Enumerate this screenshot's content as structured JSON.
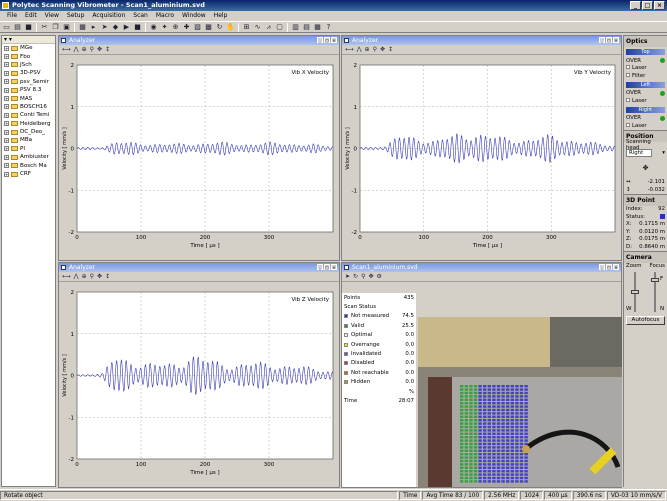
{
  "window": {
    "title": "Polytec Scanning Vibrometer - Scan1_aluminium.svd"
  },
  "menu": [
    "File",
    "Edit",
    "View",
    "Setup",
    "Acquisition",
    "Scan",
    "Macro",
    "Window",
    "Help"
  ],
  "tree": {
    "items": [
      "MGe",
      "Fbo",
      "JSch",
      "3D-PSV",
      "psv_Semir",
      "PSV 8.3",
      "MAS",
      "BOSCH16",
      "Conti Temi",
      "Heidelberg",
      "DC_Deo_",
      "MBa",
      "PI",
      "Ambiuster",
      "Bosch Ma",
      "CRF"
    ]
  },
  "analyzer_title": "Analyzer",
  "scan_window_title": "Scan1_aluminium.svd",
  "chart_data": [
    {
      "type": "line",
      "title": "",
      "xlabel": "Time [ µs ]",
      "ylabel": "Velocity [ mm/s ]",
      "legend": "Vib X Velocity",
      "legend_position": "top-right",
      "xlim": [
        0,
        400
      ],
      "ylim": [
        -2,
        2
      ],
      "xticks": [
        0,
        100,
        200,
        300
      ],
      "yticks": [
        -2,
        -1,
        0,
        1,
        2
      ],
      "grid": true,
      "color": "#2b2bb0",
      "envelope": [
        [
          0,
          0.03
        ],
        [
          40,
          0.04
        ],
        [
          60,
          0.18
        ],
        [
          100,
          0.15
        ],
        [
          140,
          0.12
        ],
        [
          180,
          0.14
        ],
        [
          220,
          0.17
        ],
        [
          260,
          0.12
        ],
        [
          300,
          0.16
        ],
        [
          340,
          0.13
        ],
        [
          370,
          0.12
        ],
        [
          380,
          0.08
        ],
        [
          400,
          0.06
        ]
      ],
      "period": 7.5
    },
    {
      "type": "line",
      "title": "",
      "xlabel": "Time [ µs ]",
      "ylabel": "Velocity [ mm/s ]",
      "legend": "Vib Y Velocity",
      "legend_position": "top-right",
      "xlim": [
        0,
        400
      ],
      "ylim": [
        -2,
        2
      ],
      "xticks": [
        0,
        100,
        200,
        300
      ],
      "yticks": [
        -2,
        -1,
        0,
        1,
        2
      ],
      "grid": true,
      "color": "#2b2bb0",
      "envelope": [
        [
          0,
          0.03
        ],
        [
          40,
          0.06
        ],
        [
          60,
          0.35
        ],
        [
          90,
          0.3
        ],
        [
          120,
          0.22
        ],
        [
          150,
          0.38
        ],
        [
          180,
          0.45
        ],
        [
          220,
          0.3
        ],
        [
          260,
          0.25
        ],
        [
          300,
          0.35
        ],
        [
          340,
          0.22
        ],
        [
          380,
          0.12
        ],
        [
          400,
          0.08
        ]
      ],
      "period": 7.5
    },
    {
      "type": "line",
      "title": "",
      "xlabel": "Time [ µs ]",
      "ylabel": "Velocity [ mm/s ]",
      "legend": "Vib Z Velocity",
      "legend_position": "top-right",
      "xlim": [
        0,
        400
      ],
      "ylim": [
        -2,
        2
      ],
      "xticks": [
        0,
        100,
        200,
        300
      ],
      "yticks": [
        -2,
        -1,
        0,
        1,
        2
      ],
      "grid": true,
      "color": "#2b2bb0",
      "envelope": [
        [
          0,
          0.02
        ],
        [
          40,
          0.05
        ],
        [
          60,
          0.55
        ],
        [
          90,
          0.4
        ],
        [
          120,
          0.3
        ],
        [
          160,
          0.35
        ],
        [
          175,
          0.6
        ],
        [
          200,
          0.45
        ],
        [
          240,
          0.3
        ],
        [
          280,
          0.35
        ],
        [
          320,
          0.3
        ],
        [
          360,
          0.22
        ],
        [
          400,
          0.12
        ]
      ],
      "period": 7.5
    }
  ],
  "scan_status": {
    "points_label": "Points",
    "points_value": "435",
    "header": "Scan Status",
    "rows": [
      {
        "label": "Not measured",
        "value": "74.5",
        "color": "#2a2ad0"
      },
      {
        "label": "Valid",
        "value": "25.5",
        "color": "#20a020"
      },
      {
        "label": "Optimal",
        "value": "0.0",
        "color": "#f0f0f0"
      },
      {
        "label": "Overrange",
        "value": "0.0",
        "color": "#f0e020"
      },
      {
        "label": "Invalidated",
        "value": "0.0",
        "color": "#7a40c0"
      },
      {
        "label": "Disabled",
        "value": "0.0",
        "color": "#c03030"
      },
      {
        "label": "Not reachable",
        "value": "0.0",
        "color": "#d06010"
      },
      {
        "label": "Hidden",
        "value": "0.0",
        "color": "#d09020"
      }
    ],
    "percent_label": "%",
    "time_label": "Time",
    "time_value": "28:07"
  },
  "right_panel": {
    "optics": "Optics",
    "top": "Top",
    "over": "OVER",
    "laser": "Laser",
    "filter": "Filter",
    "left": "Left",
    "right": "Right",
    "position": "Position",
    "scanning_head": "Scanning head",
    "head_value": "Right",
    "pos1": "-2.101",
    "pos2": "-0.032",
    "point3d": "3D Point",
    "index_label": "Index:",
    "index_value": "92",
    "status_label": "Status:",
    "x_label": "X:",
    "x_value": "0.1715 m",
    "y_label": "Y:",
    "y_value": "0.0120 m",
    "z_label": "Z:",
    "z_value": "0.0175 m",
    "d_label": "D:",
    "d_value": "0.8640 m",
    "camera": "Camera",
    "zoom": "Zoom",
    "focus": "Focus",
    "f": "F",
    "w": "W",
    "n": "N",
    "autofocus": "Autofocus"
  },
  "status_bar": {
    "left": "Rotate object",
    "time": "Time",
    "avg": "Avg Time 83 / 100",
    "freq": "2.56 MHz",
    "lines": "1024",
    "us": "400 µs",
    "res": "390.6 ns",
    "vd": "VD-03 10 mm/s/V"
  }
}
